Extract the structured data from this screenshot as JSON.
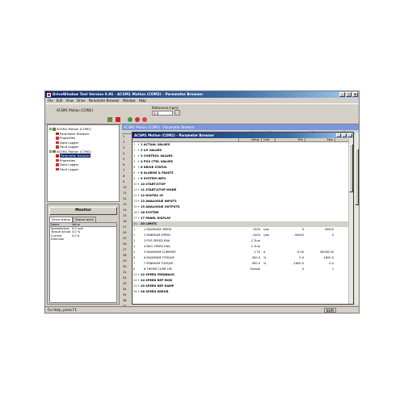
{
  "window": {
    "title": "DriveWindow Test Version 0.96 - ACSM1 Motion (COM2) - Parameter Browser",
    "min": "_",
    "max": "□",
    "close": "x"
  },
  "menu": [
    "File",
    "Edit",
    "View",
    "Drive",
    "Parameter Browser",
    "Window",
    "Help"
  ],
  "toolbar": {
    "drive_label": "ACSM1 Motion (COM2)",
    "reference_label": "Reference [rpm]",
    "reference_value": "0.0"
  },
  "tree": [
    {
      "label": "ACSM1 Motion (COM1)",
      "level": 0,
      "exp": "-"
    },
    {
      "label": "Parameter Browser",
      "level": 1
    },
    {
      "label": "Properties",
      "level": 1
    },
    {
      "label": "Data Logger",
      "level": 1
    },
    {
      "label": "Fault Logger",
      "level": 1
    },
    {
      "label": "ACSM1 Motion (COM2)",
      "level": 0,
      "exp": "-"
    },
    {
      "label": "Parameter Browser",
      "level": 1,
      "selected": true
    },
    {
      "label": "Properties",
      "level": 1
    },
    {
      "label": "Data Logger",
      "level": 1
    },
    {
      "label": "Fault Logger",
      "level": 1
    }
  ],
  "monitor": {
    "button": "Monitor",
    "tabs": [
      "Drive status",
      "Status word"
    ],
    "header": {
      "name": "Name",
      "value": "Value"
    },
    "rows": [
      {
        "name": "SpeedActual",
        "value": "0.0 rpm"
      },
      {
        "name": "Torque actual",
        "value": "0.0 %"
      },
      {
        "name": "Current",
        "value": "0.0 A"
      },
      {
        "name": "Direction",
        "value": ""
      }
    ]
  },
  "back_window": {
    "title": "ACSM1 Motion (COM1) - Parameter Browser",
    "columns": [
      "Value",
      "Unit",
      "Min",
      "Max"
    ],
    "gutter": [
      "1",
      "2",
      "3",
      "4",
      "5",
      "6",
      "7",
      "8",
      "9",
      "10",
      "11",
      "12",
      "13",
      "14",
      "15",
      "16",
      "17",
      "20",
      "25",
      "26",
      "27",
      "28",
      "29",
      "30",
      "31",
      "32",
      "33",
      "34",
      "35",
      "36",
      "37"
    ]
  },
  "parameter_browser": {
    "title": "ACSM1 Motion (COM2) - Parameter Browser",
    "columns": {
      "name": "",
      "value": "Value",
      "unit": "Unit",
      "min": "Min",
      "max": "Max"
    },
    "rows": [
      {
        "num": "1",
        "exp": "+",
        "name": "1 ACTUAL VALUES",
        "group": true
      },
      {
        "num": "2",
        "exp": "+",
        "name": "2 I/O VALUES",
        "group": true
      },
      {
        "num": "3",
        "exp": "+",
        "name": "3 CONTROL VALUES",
        "group": true
      },
      {
        "num": "4",
        "exp": "+",
        "name": "4 POS CTRL VALUES",
        "group": true
      },
      {
        "num": "6",
        "exp": "+",
        "name": "6 DRIVE STATUS",
        "group": true
      },
      {
        "num": "8",
        "exp": "+",
        "name": "8 ALARMS & FAULTS",
        "group": true
      },
      {
        "num": "9",
        "exp": "+",
        "name": "9 SYSTEM INFO",
        "group": true
      },
      {
        "num": "10",
        "exp": "+",
        "name": "10 START/STOP",
        "group": true
      },
      {
        "num": "11",
        "exp": "+",
        "name": "11 START/STOP MODE",
        "group": true
      },
      {
        "num": "12",
        "exp": "+",
        "name": "12 DIGITAL IO",
        "group": true
      },
      {
        "num": "13",
        "exp": "+",
        "name": "13 ANALOGUE INPUTS",
        "group": true
      },
      {
        "num": "15",
        "exp": "+",
        "name": "15 ANALOGUE OUTPUTS",
        "group": true
      },
      {
        "num": "16",
        "exp": "+",
        "name": "16 SYSTEM",
        "group": true
      },
      {
        "num": "17",
        "exp": "+",
        "name": "17 PANEL DISPLAY",
        "group": true
      },
      {
        "num": "20",
        "exp": "-",
        "name": "20 LIMITS",
        "group": true,
        "selected": true
      },
      {
        "num": "1",
        "exp": "",
        "name": "1 MAXIMUM SPEED",
        "value": "1500",
        "unit": "rpm",
        "min": "0",
        "max": "30000",
        "child": true
      },
      {
        "num": "2",
        "exp": "",
        "name": "2 MINIMUM SPEED",
        "value": "-1500",
        "unit": "rpm",
        "min": "-30000",
        "max": "0",
        "child": true
      },
      {
        "num": "3",
        "exp": "",
        "name": "3 POS SPEED ENA",
        "value": "C.True",
        "unit": "",
        "min": "",
        "max": "",
        "child": true
      },
      {
        "num": "4",
        "exp": "",
        "name": "4 NEG SPEED ENA",
        "value": "C.True",
        "unit": "",
        "min": "",
        "max": "",
        "child": true
      },
      {
        "num": "5",
        "exp": "",
        "name": "5 MAXIMUM CURRENT",
        "value": "1.70",
        "unit": "A",
        "min": "0.00",
        "max": "30000.00",
        "child": true
      },
      {
        "num": "6",
        "exp": "",
        "name": "6 MAXIMUM TORQUE",
        "value": "300.0",
        "unit": "%",
        "min": "0.0",
        "max": "1600.0",
        "child": true
      },
      {
        "num": "7",
        "exp": "",
        "name": "7 MINIMUM TORQUE",
        "value": "-300.0",
        "unit": "%",
        "min": "-1600.0",
        "max": "0.0",
        "child": true
      },
      {
        "num": "8",
        "exp": "",
        "name": "8 THERM CURR LIM",
        "value": "Enable",
        "unit": "",
        "min": "0",
        "max": "1",
        "child": true
      },
      {
        "num": "22",
        "exp": "+",
        "name": "22 SPEED FEEDBACK",
        "group": true
      },
      {
        "num": "24",
        "exp": "+",
        "name": "24 SPEED REF MOD",
        "group": true
      },
      {
        "num": "25",
        "exp": "+",
        "name": "25 SPEED REF RAMP",
        "group": true
      },
      {
        "num": "26",
        "exp": "+",
        "name": "26 SPEED ERROR",
        "group": true
      }
    ]
  },
  "status": {
    "text": "For Help, press F1",
    "indicator": "NUM"
  }
}
